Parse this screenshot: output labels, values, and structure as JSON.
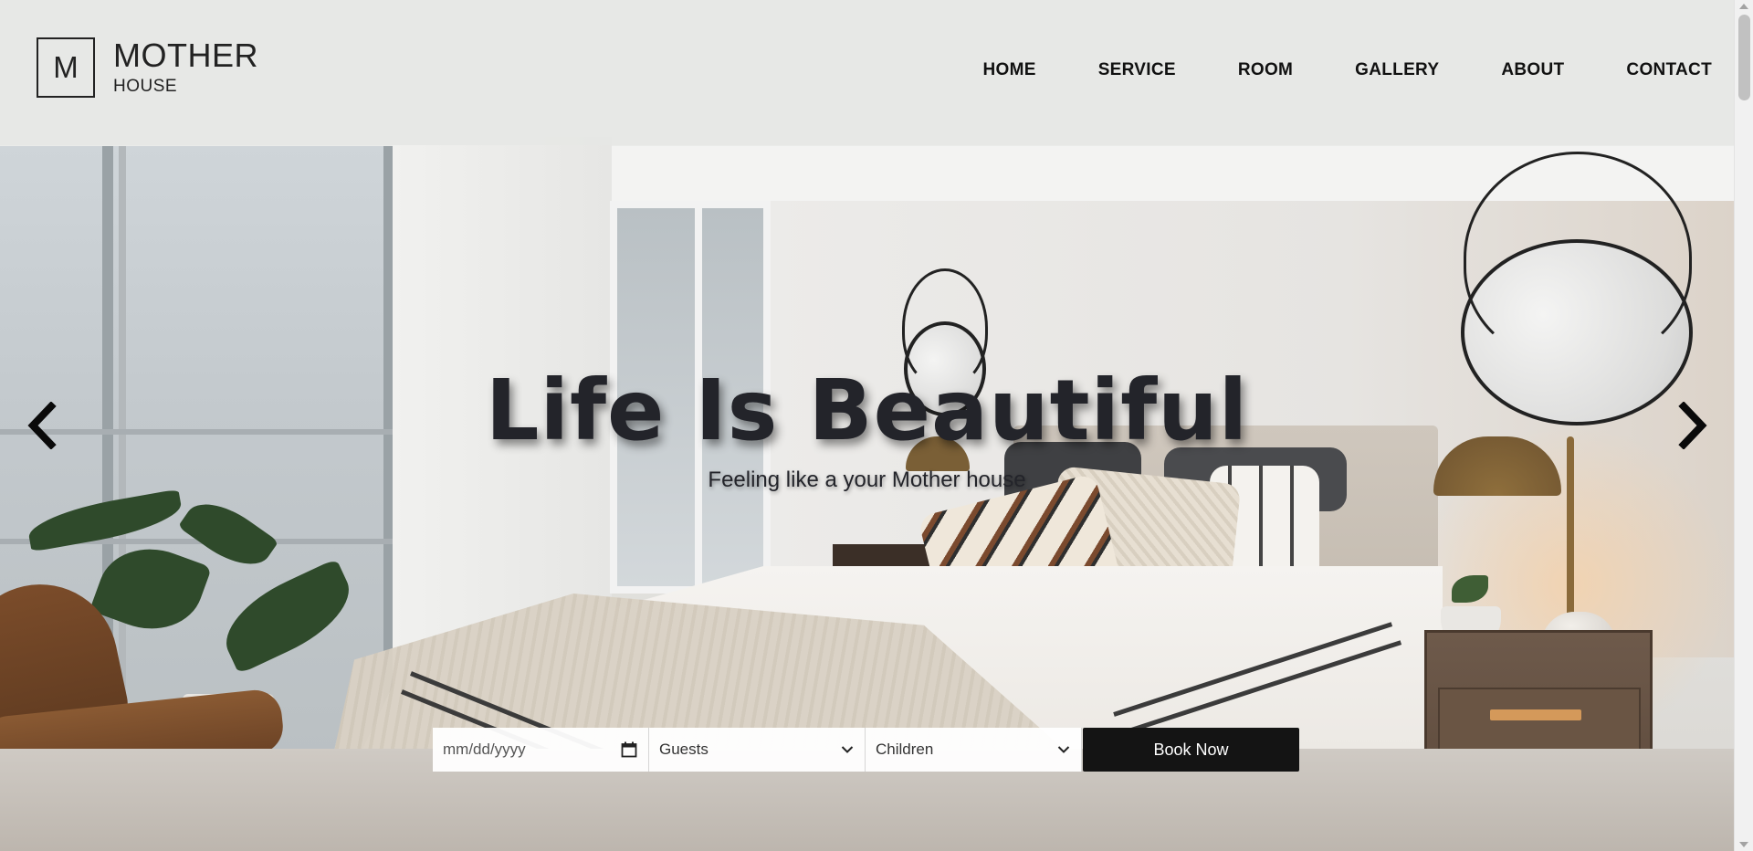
{
  "logo": {
    "letter": "M",
    "title": "MOTHER",
    "subtitle": "HOUSE"
  },
  "nav": {
    "items": [
      {
        "label": "HOME"
      },
      {
        "label": "SERVICE"
      },
      {
        "label": "ROOM"
      },
      {
        "label": "GALLERY"
      },
      {
        "label": "ABOUT"
      },
      {
        "label": "CONTACT"
      }
    ]
  },
  "hero": {
    "title": "Life Is Beautiful",
    "subtitle": "Feeling like a your Mother house",
    "prev_icon": "chevron-left-icon",
    "next_icon": "chevron-right-icon"
  },
  "booking": {
    "date_placeholder": "mm/dd/yyyy",
    "date_icon": "calendar-icon",
    "guests_label": "Guests",
    "children_label": "Children",
    "dropdown_icon": "chevron-down-icon",
    "button_label": "Book Now"
  },
  "colors": {
    "header_bg": "#e6e7e5",
    "text_dark": "#23242a",
    "button_bg": "#141414",
    "lamp_glow": "#ffcd96",
    "drawer_handle": "#d4995a"
  }
}
